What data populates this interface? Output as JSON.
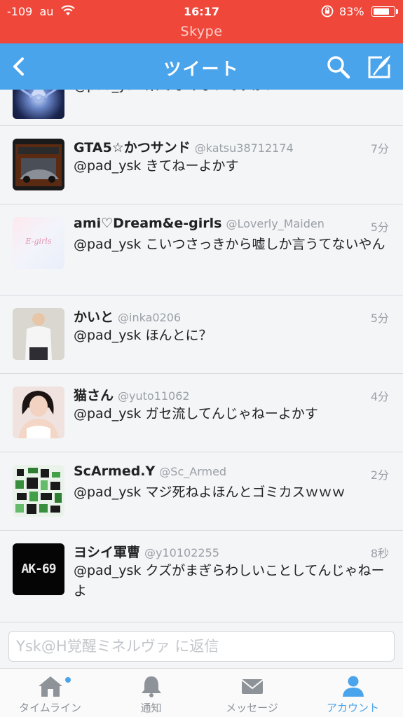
{
  "status_bar": {
    "signal": "-109",
    "carrier": "au",
    "time": "16:17",
    "battery_percent": "83%",
    "battery_level": 0.83,
    "call_app": "Skype"
  },
  "nav": {
    "title": "ツイート"
  },
  "tweets": [
    {
      "name": "",
      "handle": "",
      "time": "",
      "text": "@pad_ysk 来てなくないですか？"
    },
    {
      "name": "GTA5☆かつサンド",
      "handle": "@katsu38712174",
      "time": "7分",
      "text": "@pad_ysk きてねーよかす"
    },
    {
      "name": "ami♡Dream&e-girls",
      "handle": "@Loverly_Maiden",
      "time": "5分",
      "text": "@pad_ysk こいつさっきから嘘しか言うてないやん"
    },
    {
      "name": "かいと",
      "handle": "@inka0206",
      "time": "5分",
      "text": "@pad_ysk ほんとに？"
    },
    {
      "name": "猫さん",
      "handle": "@yuto11062",
      "time": "4分",
      "text": "@pad_ysk ガセ流してんじゃねーよかす"
    },
    {
      "name": "ScArmed.Y",
      "handle": "@Sc_Armed",
      "time": "2分",
      "text": "@pad_ysk マジ死ねよほんとゴミカスｗｗｗ"
    },
    {
      "name": "ヨシイ軍曹",
      "handle": "@y10102255",
      "time": "8秒",
      "text": "@pad_ysk クズがまぎらわしいことしてんじゃねーよ"
    }
  ],
  "avatar_text": {
    "ami": "E-girls",
    "yoshii": "AK-69"
  },
  "reply": {
    "placeholder": "Ysk@H覚醒ミネルヴァ に返信",
    "value": ""
  },
  "tabs": [
    {
      "label": "タイムライン",
      "icon": "home-icon"
    },
    {
      "label": "通知",
      "icon": "bell-icon"
    },
    {
      "label": "メッセージ",
      "icon": "envelope-icon"
    },
    {
      "label": "アカウント",
      "icon": "person-icon",
      "active": true
    }
  ],
  "colors": {
    "status_bar": "#f0473b",
    "nav_bar": "#4aa4ec",
    "accent": "#4aa4ec"
  }
}
